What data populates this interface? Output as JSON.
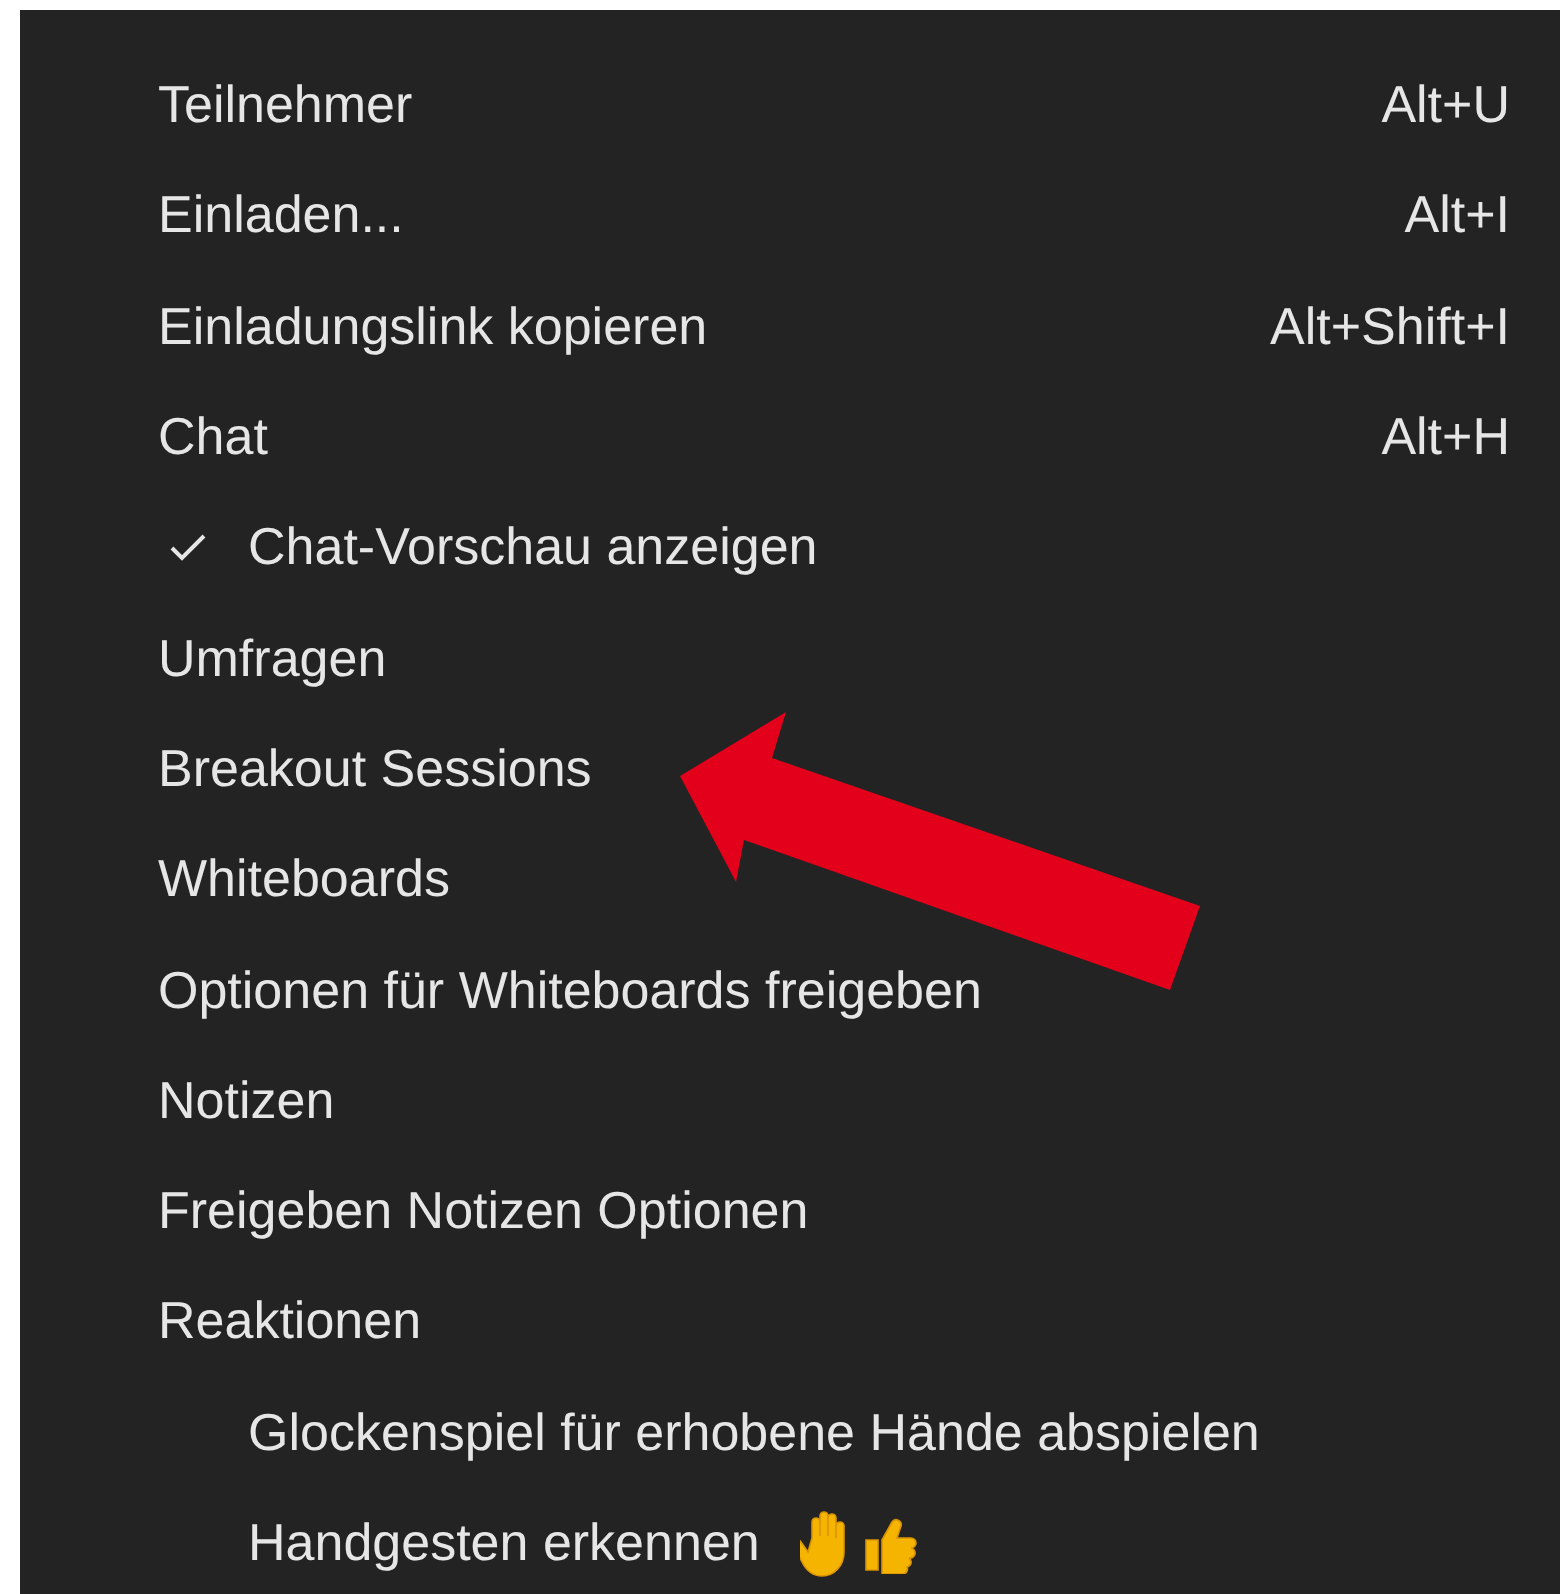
{
  "menu": {
    "items": [
      {
        "kind": "item",
        "label": "Teilnehmer",
        "shortcut": "Alt+U"
      },
      {
        "kind": "item",
        "label": "Einladen...",
        "shortcut": "Alt+I"
      },
      {
        "kind": "item",
        "label": "Einladungslink kopieren",
        "shortcut": "Alt+Shift+I"
      },
      {
        "kind": "item",
        "label": "Chat",
        "shortcut": "Alt+H"
      },
      {
        "kind": "check",
        "label": "Chat-Vorschau anzeigen",
        "checked": true
      },
      {
        "kind": "item",
        "label": "Umfragen"
      },
      {
        "kind": "item",
        "label": "Breakout Sessions"
      },
      {
        "kind": "item",
        "label": "Whiteboards"
      },
      {
        "kind": "item",
        "label": "Optionen für Whiteboards freigeben"
      },
      {
        "kind": "item",
        "label": "Notizen"
      },
      {
        "kind": "item",
        "label": "Freigeben Notizen Optionen"
      },
      {
        "kind": "item",
        "label": "Reaktionen"
      },
      {
        "kind": "check",
        "label": "Glockenspiel für erhobene Hände abspielen",
        "checked": false
      },
      {
        "kind": "check",
        "label": "Handgesten erkennen",
        "checked": false,
        "gesture_icons": true
      }
    ]
  }
}
